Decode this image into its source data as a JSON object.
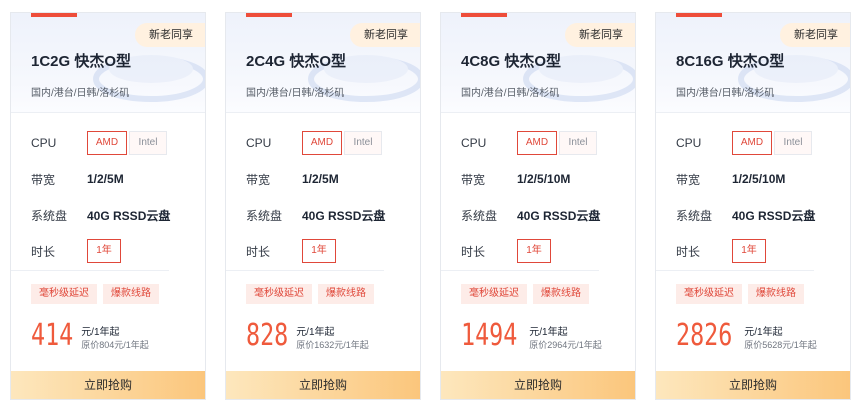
{
  "plans": [
    {
      "badge": "新老同享",
      "title": "1C2G 快杰O型",
      "regions": "国内/港台/日韩/洛杉矶",
      "cpu_label": "CPU",
      "cpu_options": [
        "AMD",
        "Intel"
      ],
      "cpu_selected": "AMD",
      "bandwidth_label": "带宽",
      "bandwidth": "1/2/5M",
      "disk_label": "系统盘",
      "disk": "40G RSSD云盘",
      "duration_label": "时长",
      "duration": "1年",
      "tags": [
        "毫秒级延迟",
        "爆款线路"
      ],
      "price": "414",
      "price_unit": "元/1年起",
      "original_price": "原价804元/1年起",
      "buy_label": "立即抢购"
    },
    {
      "badge": "新老同享",
      "title": "2C4G 快杰O型",
      "regions": "国内/港台/日韩/洛杉矶",
      "cpu_label": "CPU",
      "cpu_options": [
        "AMD",
        "Intel"
      ],
      "cpu_selected": "AMD",
      "bandwidth_label": "带宽",
      "bandwidth": "1/2/5M",
      "disk_label": "系统盘",
      "disk": "40G RSSD云盘",
      "duration_label": "时长",
      "duration": "1年",
      "tags": [
        "毫秒级延迟",
        "爆款线路"
      ],
      "price": "828",
      "price_unit": "元/1年起",
      "original_price": "原价1632元/1年起",
      "buy_label": "立即抢购"
    },
    {
      "badge": "新老同享",
      "title": "4C8G 快杰O型",
      "regions": "国内/港台/日韩/洛杉矶",
      "cpu_label": "CPU",
      "cpu_options": [
        "AMD",
        "Intel"
      ],
      "cpu_selected": "AMD",
      "bandwidth_label": "带宽",
      "bandwidth": "1/2/5/10M",
      "disk_label": "系统盘",
      "disk": "40G RSSD云盘",
      "duration_label": "时长",
      "duration": "1年",
      "tags": [
        "毫秒级延迟",
        "爆款线路"
      ],
      "price": "1494",
      "price_unit": "元/1年起",
      "original_price": "原价2964元/1年起",
      "buy_label": "立即抢购"
    },
    {
      "badge": "新老同享",
      "title": "8C16G 快杰O型",
      "regions": "国内/港台/日韩/洛杉矶",
      "cpu_label": "CPU",
      "cpu_options": [
        "AMD",
        "Intel"
      ],
      "cpu_selected": "AMD",
      "bandwidth_label": "带宽",
      "bandwidth": "1/2/5/10M",
      "disk_label": "系统盘",
      "disk": "40G RSSD云盘",
      "duration_label": "时长",
      "duration": "1年",
      "tags": [
        "毫秒级延迟",
        "爆款线路"
      ],
      "price": "2826",
      "price_unit": "元/1年起",
      "original_price": "原价5628元/1年起",
      "buy_label": "立即抢购"
    }
  ],
  "colors": {
    "accent": "#ee4d3a",
    "price": "#ef5a3c",
    "buy_start": "#fde7bd",
    "buy_end": "#fbc67c"
  }
}
